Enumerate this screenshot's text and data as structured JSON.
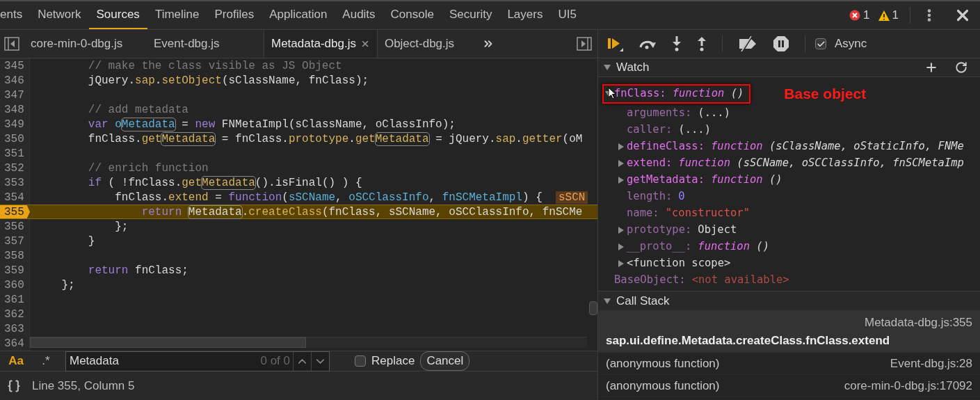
{
  "panel_tabs": [
    {
      "label": "ents",
      "selected": false
    },
    {
      "label": "Network",
      "selected": false
    },
    {
      "label": "Sources",
      "selected": true
    },
    {
      "label": "Timeline",
      "selected": false
    },
    {
      "label": "Profiles",
      "selected": false
    },
    {
      "label": "Application",
      "selected": false
    },
    {
      "label": "Audits",
      "selected": false
    },
    {
      "label": "Console",
      "selected": false
    },
    {
      "label": "Security",
      "selected": false
    },
    {
      "label": "Layers",
      "selected": false
    },
    {
      "label": "UI5",
      "selected": false
    }
  ],
  "status_counts": {
    "errors": "1",
    "warnings": "1"
  },
  "file_tabs": [
    {
      "label": "core-min-0-dbg.js",
      "selected": false,
      "closable": false
    },
    {
      "label": "Event-dbg.js",
      "selected": false,
      "closable": false
    },
    {
      "label": "Metadata-dbg.js",
      "selected": true,
      "closable": true
    },
    {
      "label": "Object-dbg.js",
      "selected": false,
      "closable": false
    }
  ],
  "code_lines": [
    {
      "number": "345",
      "current": false,
      "segments": [
        {
          "kind": "comment",
          "text": "        // make the class visible as JS Object"
        }
      ]
    },
    {
      "number": "346",
      "current": false,
      "segments": [
        {
          "kind": "plain",
          "text": "        jQuery."
        },
        {
          "kind": "method",
          "text": "sap"
        },
        {
          "kind": "plain",
          "text": "."
        },
        {
          "kind": "method",
          "text": "setObject"
        },
        {
          "kind": "plain",
          "text": "(sClassName, fnClass);"
        }
      ]
    },
    {
      "number": "347",
      "current": false
    },
    {
      "number": "348",
      "current": false,
      "segments": [
        {
          "kind": "comment",
          "text": "        // add metadata"
        }
      ]
    },
    {
      "number": "349",
      "current": false,
      "segments": [
        {
          "kind": "keyword",
          "text": "        var "
        },
        {
          "kind": "param",
          "text": "o"
        },
        {
          "kind": "match_param",
          "text": "Metadata"
        },
        {
          "kind": "plain",
          "text": " = "
        },
        {
          "kind": "keyword",
          "text": "new"
        },
        {
          "kind": "plain",
          "text": " FNMetaImpl(sClassName, oClassInfo);"
        }
      ]
    },
    {
      "number": "350",
      "current": false,
      "segments": [
        {
          "kind": "plain",
          "text": "        fnClass."
        },
        {
          "kind": "method",
          "text": "get"
        },
        {
          "kind": "match_method",
          "text": "Metadata"
        },
        {
          "kind": "plain",
          "text": " = fnClass."
        },
        {
          "kind": "method",
          "text": "prototype"
        },
        {
          "kind": "plain",
          "text": "."
        },
        {
          "kind": "method",
          "text": "get"
        },
        {
          "kind": "match_method",
          "text": "Metadata"
        },
        {
          "kind": "plain",
          "text": " = jQuery."
        },
        {
          "kind": "method",
          "text": "sap"
        },
        {
          "kind": "plain",
          "text": "."
        },
        {
          "kind": "method",
          "text": "getter"
        },
        {
          "kind": "plain",
          "text": "(oM"
        }
      ]
    },
    {
      "number": "351",
      "current": false
    },
    {
      "number": "352",
      "current": false,
      "segments": [
        {
          "kind": "comment",
          "text": "        // enrich function"
        }
      ]
    },
    {
      "number": "353",
      "current": false,
      "segments": [
        {
          "kind": "keyword",
          "text": "        if"
        },
        {
          "kind": "plain",
          "text": " ( !fnClass."
        },
        {
          "kind": "method",
          "text": "get"
        },
        {
          "kind": "match_method",
          "text": "Metadata"
        },
        {
          "kind": "plain",
          "text": "().isFinal() ) {"
        }
      ]
    },
    {
      "number": "354",
      "current": false,
      "segments": [
        {
          "kind": "plain",
          "text": "            fnClass."
        },
        {
          "kind": "method",
          "text": "extend"
        },
        {
          "kind": "plain",
          "text": " = "
        },
        {
          "kind": "keyword",
          "text": "function"
        },
        {
          "kind": "plain",
          "text": "("
        },
        {
          "kind": "param",
          "text": "sSCName"
        },
        {
          "kind": "plain",
          "text": ", "
        },
        {
          "kind": "param",
          "text": "oSCClassInfo"
        },
        {
          "kind": "plain",
          "text": ", "
        },
        {
          "kind": "param",
          "text": "fnSCMetaImpl"
        },
        {
          "kind": "plain",
          "text": ") {  "
        },
        {
          "kind": "inline_value",
          "text": "sSCN"
        }
      ]
    },
    {
      "number": "355",
      "current": true,
      "segments": [
        {
          "kind": "keyword",
          "text": "                return "
        },
        {
          "kind": "match",
          "text": "Metadata"
        },
        {
          "kind": "plain",
          "text": "."
        },
        {
          "kind": "method",
          "text": "createClass"
        },
        {
          "kind": "plain",
          "text": "(fnClass, sSCName, oSCClassInfo, fnSCMe"
        }
      ]
    },
    {
      "number": "356",
      "current": false,
      "segments": [
        {
          "kind": "plain",
          "text": "            };"
        }
      ]
    },
    {
      "number": "357",
      "current": false,
      "segments": [
        {
          "kind": "plain",
          "text": "        }"
        }
      ]
    },
    {
      "number": "358",
      "current": false
    },
    {
      "number": "359",
      "current": false,
      "segments": [
        {
          "kind": "keyword",
          "text": "        return"
        },
        {
          "kind": "plain",
          "text": " fnClass;"
        }
      ]
    },
    {
      "number": "360",
      "current": false,
      "segments": [
        {
          "kind": "plain",
          "text": "    };"
        }
      ]
    },
    {
      "number": "361",
      "current": false
    },
    {
      "number": "362",
      "current": false
    },
    {
      "number": "363",
      "current": false
    },
    {
      "number": "364",
      "current": false
    }
  ],
  "search_bar": {
    "match_case": {
      "label": "Aa",
      "on": true
    },
    "regex": {
      "label": ".*",
      "on": false
    },
    "query": "Metadata",
    "count": "0 of 0",
    "replace": {
      "label": "Replace",
      "checked": false
    },
    "cancel": "Cancel"
  },
  "status_bar": {
    "position": "Line 355, Column 5"
  },
  "debugger_toolbar": {
    "async": {
      "label": "Async",
      "checked": true
    }
  },
  "watch": {
    "title": "Watch",
    "expanded": true,
    "items": [
      {
        "key": "fnClass:",
        "dimmed": false,
        "kind": "function",
        "value": "function",
        "signature": "()",
        "expanded": true,
        "callout": "Base object",
        "children": [
          {
            "key": "arguments:",
            "dimmed": true,
            "kind": "plain",
            "value": "(...)"
          },
          {
            "key": "caller:",
            "dimmed": true,
            "kind": "plain",
            "value": "(...)"
          },
          {
            "key": "defineClass:",
            "dimmed": false,
            "kind": "function",
            "value": "function",
            "signature": "(sClassName, oStaticInfo, FNMe",
            "expanded": false
          },
          {
            "key": "extend:",
            "dimmed": false,
            "kind": "function",
            "value": "function",
            "signature": "(sSCName, oSCClassInfo, fnSCMetaImp",
            "expanded": false
          },
          {
            "key": "getMetadata:",
            "dimmed": false,
            "kind": "function",
            "value": "function",
            "signature": "()",
            "expanded": false
          },
          {
            "key": "length:",
            "dimmed": true,
            "kind": "number",
            "value": "0"
          },
          {
            "key": "name:",
            "dimmed": true,
            "kind": "string",
            "value": "\"constructor\""
          },
          {
            "key": "prototype:",
            "dimmed": true,
            "kind": "object",
            "value": "Object",
            "expanded": false
          },
          {
            "key": "__proto__:",
            "dimmed": true,
            "kind": "function",
            "value": "function",
            "signature": "()",
            "expanded": false
          },
          {
            "key": "<function scope>",
            "kind": "scope",
            "expanded": false
          }
        ]
      },
      {
        "key": "BaseObject:",
        "dimmed": true,
        "kind": "unavailable",
        "value": "<not available>"
      }
    ]
  },
  "call_stack": {
    "title": "Call Stack",
    "expanded": true,
    "frames": [
      {
        "function": "sap.ui.define.Metadata.createClass.fnClass.extend",
        "location": "Metadata-dbg.js:355",
        "selected": true
      },
      {
        "function": "(anonymous function)",
        "location": "Event-dbg.js:28",
        "selected": false
      },
      {
        "function": "(anonymous function)",
        "location": "core-min-0-dbg.js:17092",
        "selected": false
      }
    ]
  }
}
